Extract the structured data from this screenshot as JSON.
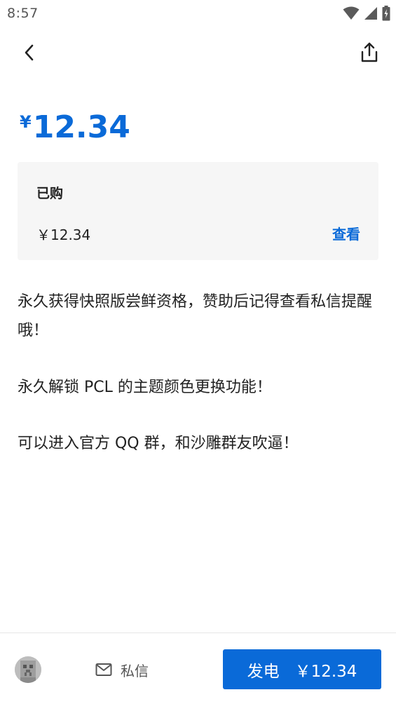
{
  "status_bar": {
    "time": "8:57",
    "icons": [
      "wifi-icon",
      "signal-icon",
      "battery-icon"
    ]
  },
  "top_bar": {
    "back_icon": "chevron-left-icon",
    "share_icon": "share-icon"
  },
  "price_header": {
    "currency": "¥",
    "amount": "12.34"
  },
  "purchased_card": {
    "title": "已购",
    "price": "￥12.34",
    "view_label": "查看"
  },
  "description": {
    "line1": "永久获得快照版尝鲜资格，赞助后记得查看私信提醒哦！",
    "line2": "永久解锁 PCL 的主题颜色更换功能！",
    "line3": "可以进入官方 QQ 群，和沙雕群友吹逼！"
  },
  "bottom_bar": {
    "message_icon": "mail-icon",
    "message_label": "私信",
    "charge_label": "发电",
    "charge_price": "￥12.34"
  },
  "colors": {
    "accent": "#0a6ad8",
    "card_bg": "#f6f6f6",
    "text": "#222222"
  }
}
